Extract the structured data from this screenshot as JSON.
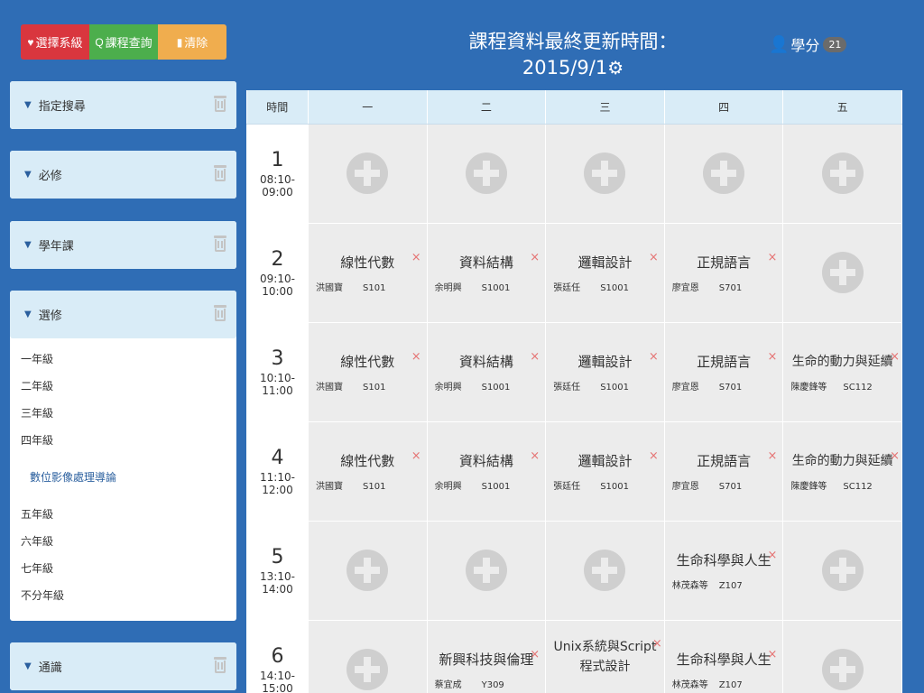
{
  "toolbar": {
    "select_dept": "選擇系級",
    "course_search": "課程查詢",
    "clear": "清除"
  },
  "header": {
    "update_line1": "課程資料最終更新時間：",
    "update_line2": "2015/9/1"
  },
  "credits": {
    "label": "學分",
    "count": "21"
  },
  "sidebar": {
    "panels": [
      {
        "label": "指定搜尋"
      },
      {
        "label": "必修"
      },
      {
        "label": "學年課"
      },
      {
        "label": "選修"
      },
      {
        "label": "通識"
      }
    ],
    "electives": {
      "grades": [
        "一年級",
        "二年級",
        "三年級",
        "四年級"
      ],
      "course": "數位影像處理導論",
      "grades_after": [
        "五年級",
        "六年級",
        "七年級",
        "不分年級"
      ]
    }
  },
  "timetable": {
    "headers": [
      "時間",
      "一",
      "二",
      "三",
      "四",
      "五"
    ],
    "periods": [
      {
        "num": "1",
        "range": "08:10-09:00"
      },
      {
        "num": "2",
        "range": "09:10-10:00"
      },
      {
        "num": "3",
        "range": "10:10-11:00"
      },
      {
        "num": "4",
        "range": "11:10-12:00"
      },
      {
        "num": "5",
        "range": "13:10-14:00"
      },
      {
        "num": "6",
        "range": "14:10-15:00"
      }
    ],
    "courses": {
      "linalg": {
        "name": "線性代數",
        "teacher": "洪國寶",
        "room": "S101"
      },
      "ds": {
        "name": "資料結構",
        "teacher": "余明興",
        "room": "S1001"
      },
      "logic": {
        "name": "邏輯設計",
        "teacher": "張廷任",
        "room": "S1001"
      },
      "regex": {
        "name": "正規語言",
        "teacher": "廖宜恩",
        "room": "S701"
      },
      "life": {
        "name": "生命的動力與延續",
        "teacher": "陳慶鋒等",
        "room": "SC112"
      },
      "lifesci": {
        "name": "生命科學與人生",
        "teacher": "林茂森等",
        "room": "Z107"
      },
      "ethics": {
        "name": "新興科技與倫理",
        "teacher": "蔡宜成",
        "room": "Y309"
      },
      "unix_l1": "Unix系統與Script",
      "unix_l2": "程式設計",
      "remove": "×"
    }
  }
}
